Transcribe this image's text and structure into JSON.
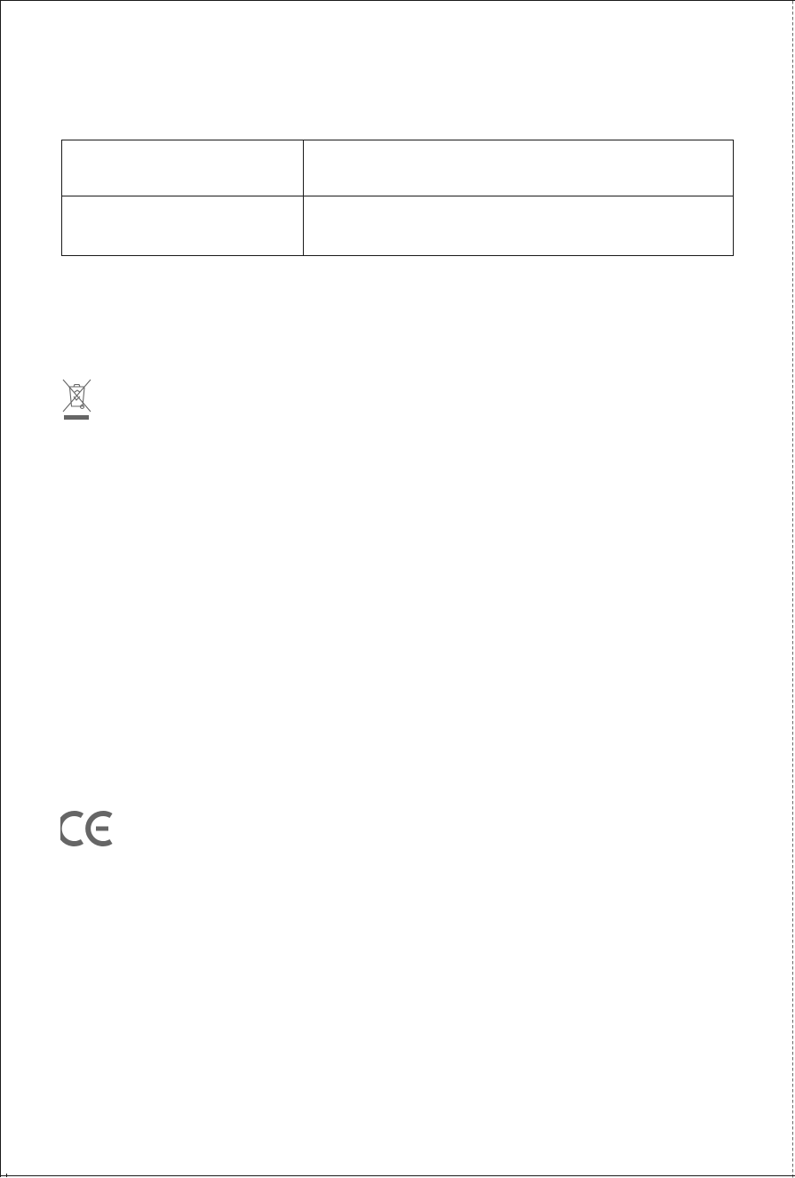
{
  "table": {
    "rows": [
      {
        "label": "",
        "value": ""
      },
      {
        "label": "",
        "value": ""
      }
    ]
  },
  "icons": {
    "disposal": "crossed-out-wheelie-bin-icon",
    "conformity": "ce-mark-icon"
  },
  "colors": {
    "border": "#1a1a1a",
    "icon": "#666666"
  }
}
